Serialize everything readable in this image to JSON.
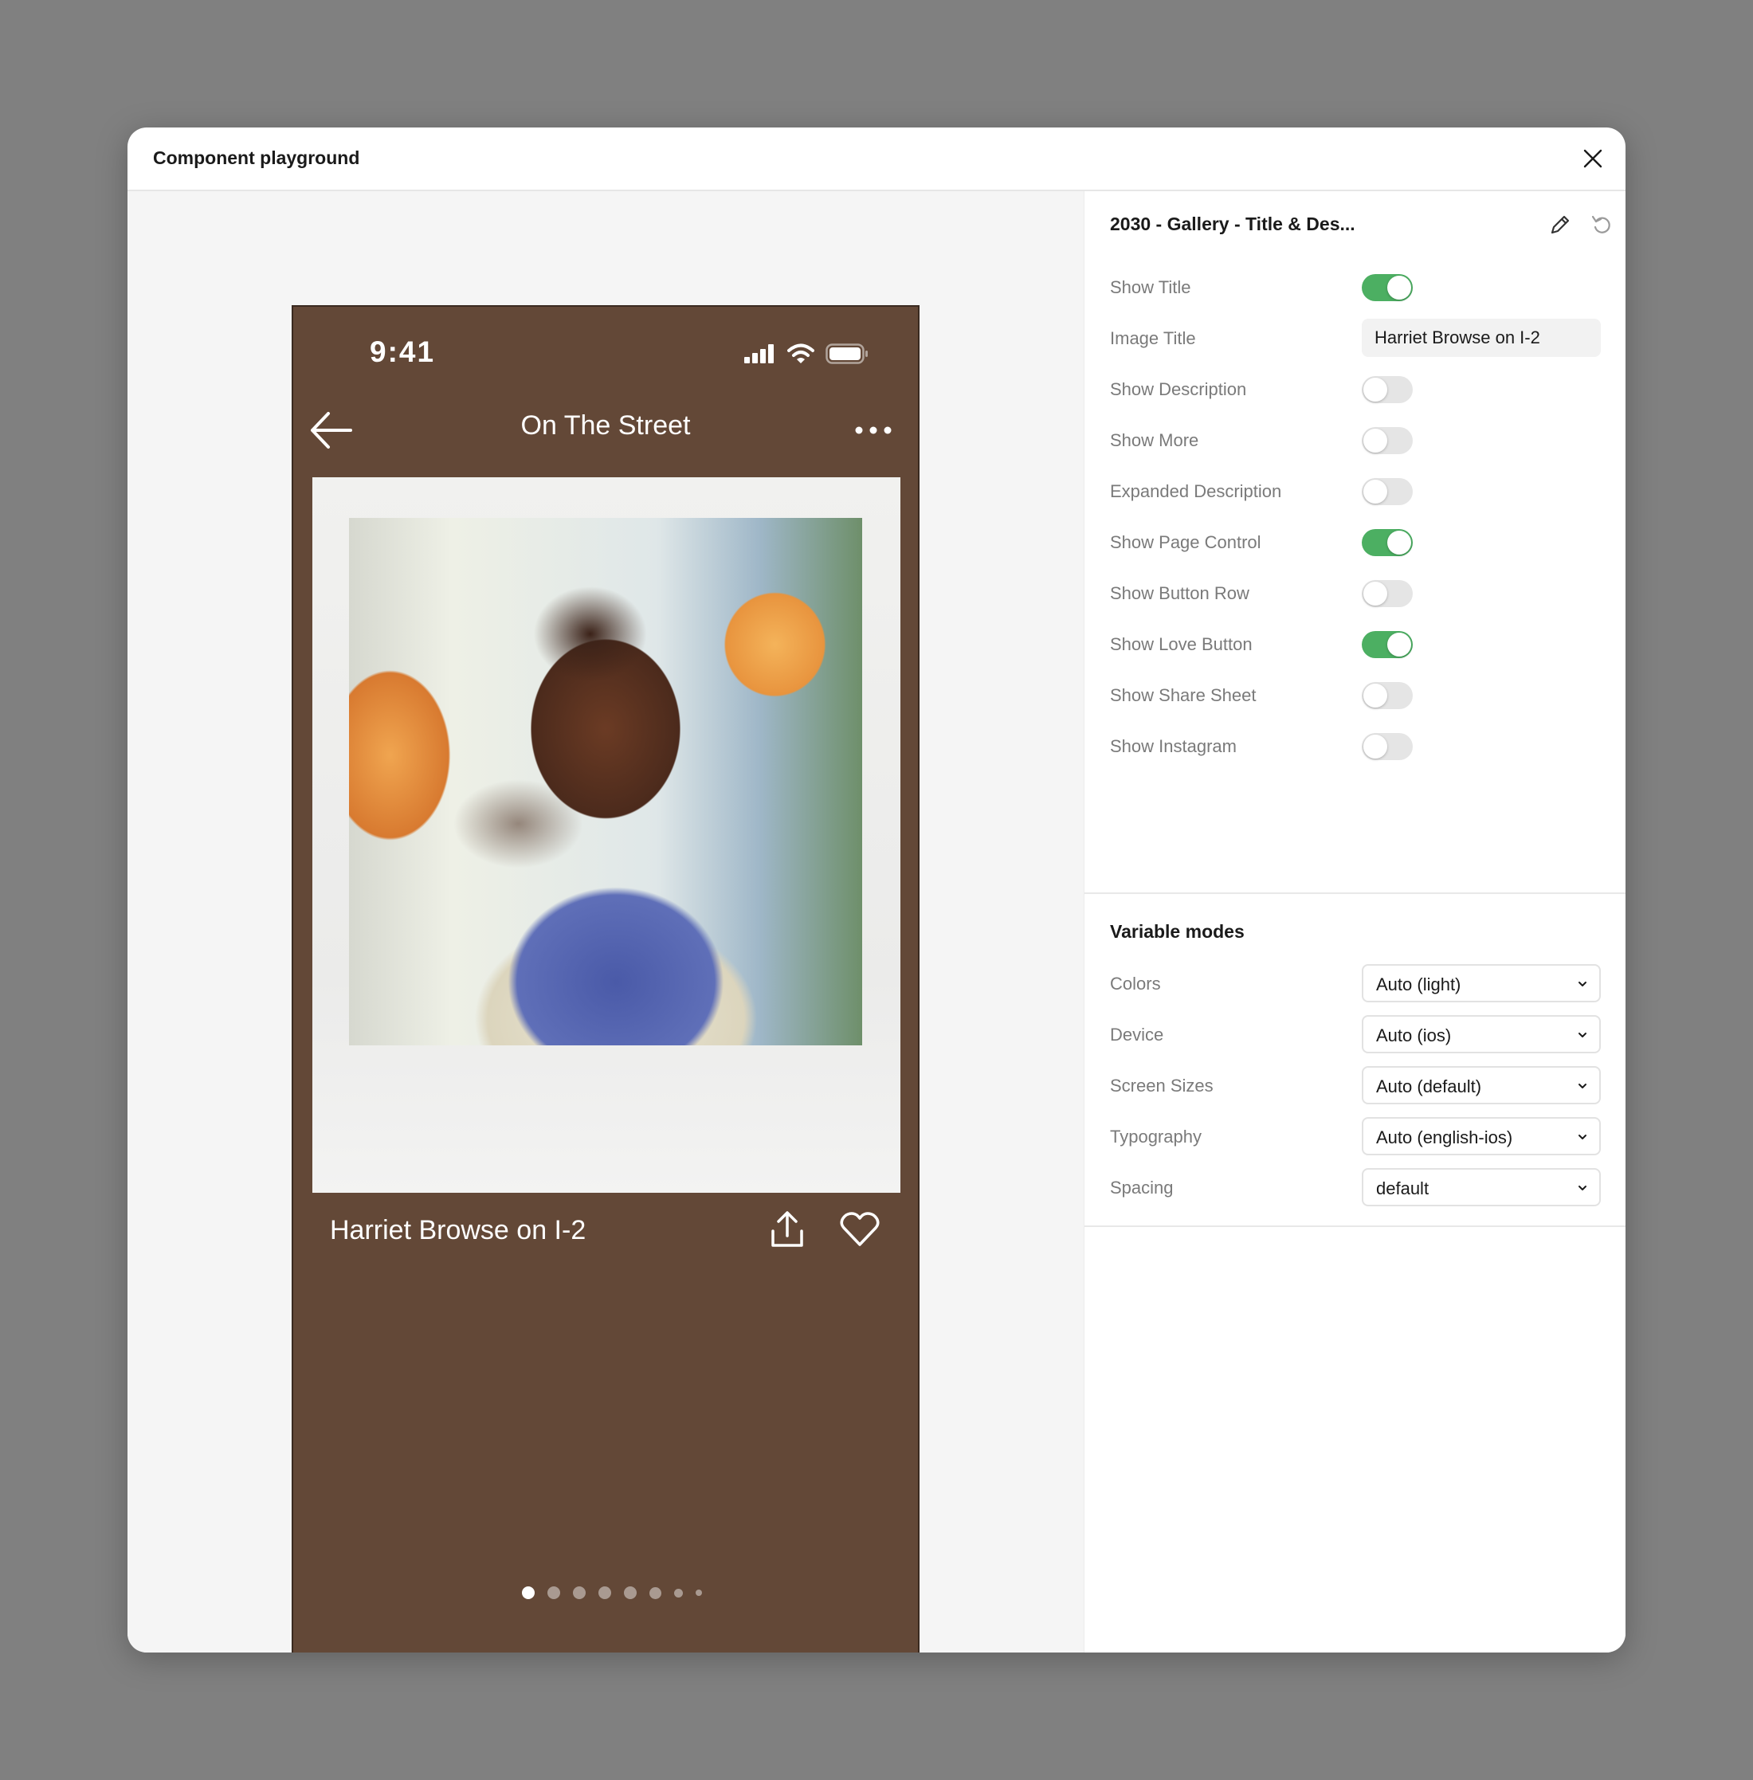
{
  "modal": {
    "title": "Component playground"
  },
  "phone": {
    "status_time": "9:41",
    "nav_title": "On The Street",
    "caption": "Harriet Browse on I-2",
    "page_dots": 8,
    "active_dot": 0,
    "background": "#634837"
  },
  "panel": {
    "title": "2030 - Gallery - Title & Des...",
    "properties": [
      {
        "label": "Show Title",
        "type": "toggle",
        "on": true
      },
      {
        "label": "Image Title",
        "type": "text",
        "value": "Harriet Browse on I-2"
      },
      {
        "label": "Show Description",
        "type": "toggle",
        "on": false
      },
      {
        "label": "Show More",
        "type": "toggle",
        "on": false
      },
      {
        "label": "Expanded Description",
        "type": "toggle",
        "on": false
      },
      {
        "label": "Show Page Control",
        "type": "toggle",
        "on": true
      },
      {
        "label": "Show Button Row",
        "type": "toggle",
        "on": false
      },
      {
        "label": "Show Love Button",
        "type": "toggle",
        "on": true
      },
      {
        "label": "Show Share Sheet",
        "type": "toggle",
        "on": false
      },
      {
        "label": "Show Instagram",
        "type": "toggle",
        "on": false
      }
    ],
    "variable_modes": {
      "title": "Variable modes",
      "items": [
        {
          "label": "Colors",
          "value": "Auto (light)"
        },
        {
          "label": "Device",
          "value": "Auto (ios)"
        },
        {
          "label": "Screen Sizes",
          "value": "Auto (default)"
        },
        {
          "label": "Typography",
          "value": "Auto (english-ios)"
        },
        {
          "label": "Spacing",
          "value": "default"
        }
      ]
    }
  },
  "colors": {
    "toggle_on": "#4caf62",
    "toggle_off": "#e5e5e5"
  },
  "icons": [
    "close-icon",
    "back-arrow-icon",
    "more-icon",
    "share-icon",
    "heart-icon",
    "lightbulb-icon",
    "edit-icon",
    "reset-icon",
    "chevron-down-icon",
    "signal-icon",
    "wifi-icon",
    "battery-icon"
  ]
}
